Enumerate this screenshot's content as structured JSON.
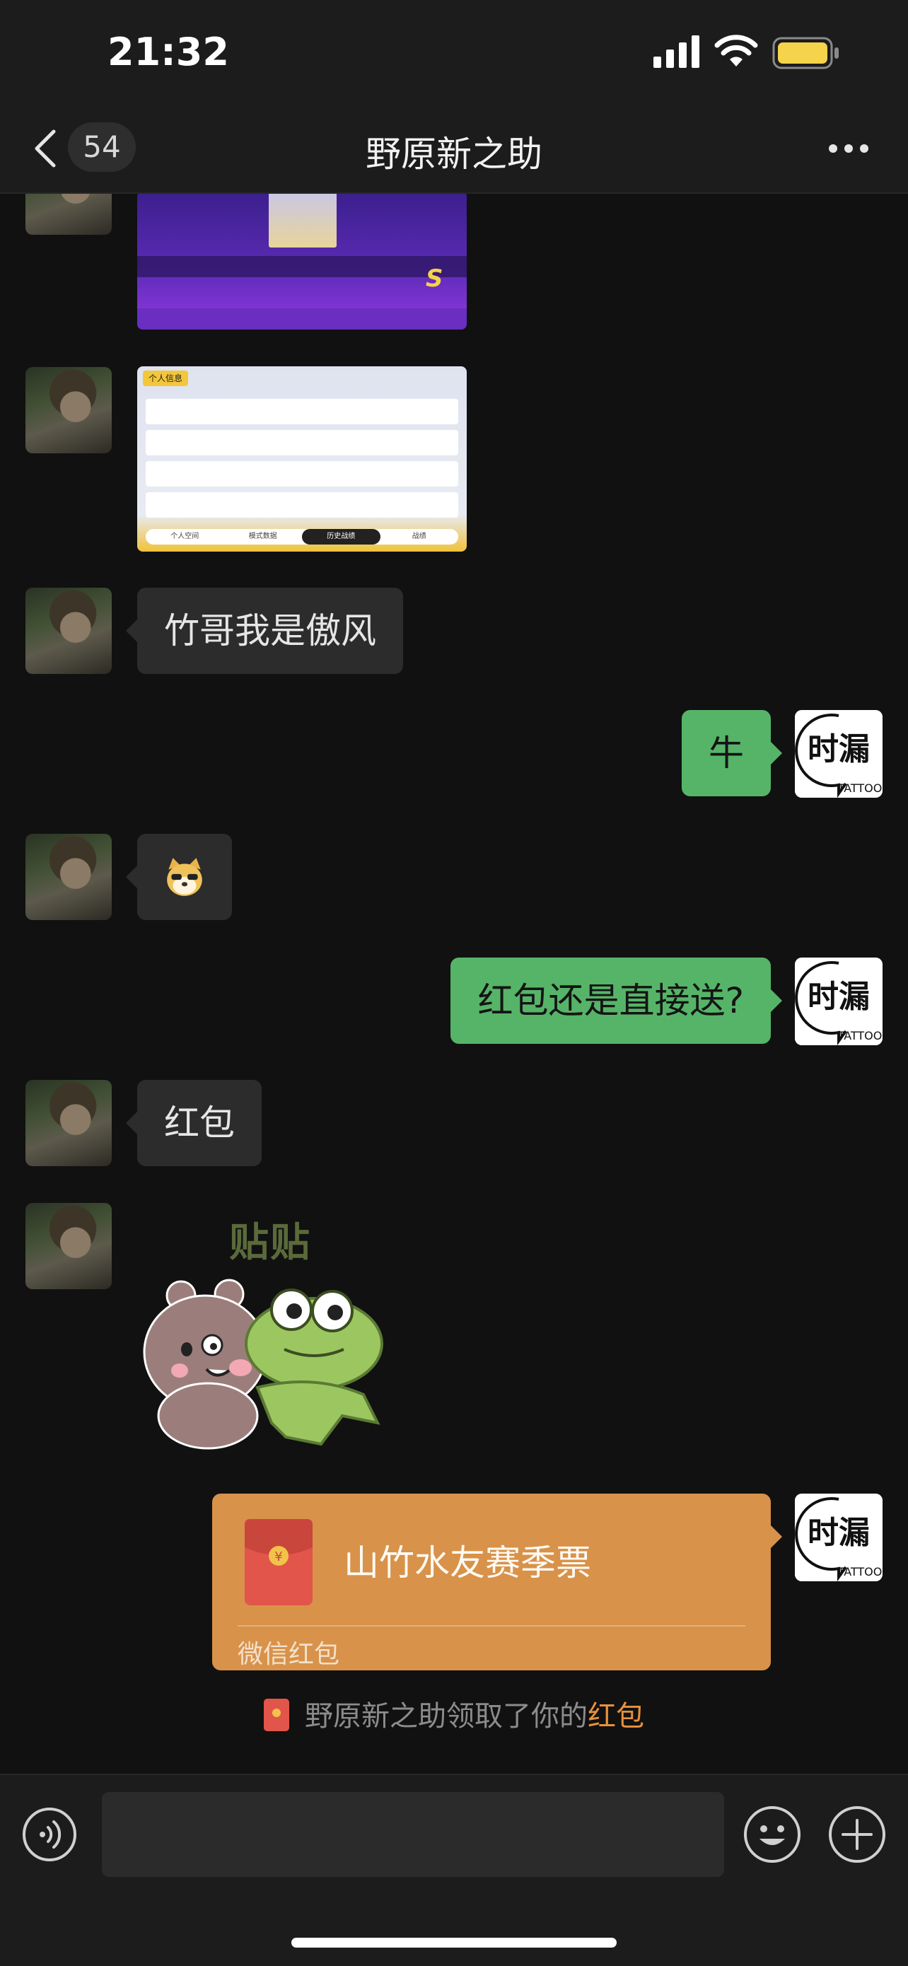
{
  "status_bar": {
    "time": "21:32",
    "icons": [
      "signal-icon",
      "wifi-icon",
      "battery-icon"
    ],
    "battery_color": "#f5d34a"
  },
  "header": {
    "back_icon": "chevron-left-icon",
    "unread_count": "54",
    "title": "野原新之助",
    "more_icon": "more-dots-icon"
  },
  "messages": [
    {
      "side": "left",
      "type": "image",
      "description_icon": "game-screenshot"
    },
    {
      "side": "left",
      "type": "image",
      "description_icon": "game-stats-screenshot",
      "tab_badge": "个人信息",
      "bottom_tabs": [
        "个人空间",
        "模式数据",
        "历史战绩",
        "战绩"
      ]
    },
    {
      "side": "left",
      "type": "text",
      "text": "竹哥我是傲风"
    },
    {
      "side": "right",
      "type": "text",
      "text": "牛"
    },
    {
      "side": "left",
      "type": "sticker",
      "icon": "doge-emoji-icon"
    },
    {
      "side": "right",
      "type": "text",
      "text": "红包还是直接送?"
    },
    {
      "side": "left",
      "type": "text",
      "text": "红包"
    },
    {
      "side": "left",
      "type": "sticker",
      "icon": "bear-frog-sticker",
      "caption": "贴贴"
    },
    {
      "side": "right",
      "type": "red_packet",
      "title": "山竹水友赛季票",
      "footer": "微信红包"
    }
  ],
  "self_avatar": {
    "line1": "时漏",
    "line2": "TATTOO"
  },
  "system_message": {
    "prefix": "野原新之助领取了你的",
    "highlight": "红包",
    "highlight_color": "#e8913c"
  },
  "input_bar": {
    "placeholder": "",
    "voice_icon": "voice-icon",
    "emoji_icon": "emoji-icon",
    "plus_icon": "plus-icon"
  },
  "colors": {
    "background": "#111111",
    "bubble_self": "#56b468",
    "bubble_other": "#2c2c2c",
    "red_packet": "#d8924a"
  }
}
